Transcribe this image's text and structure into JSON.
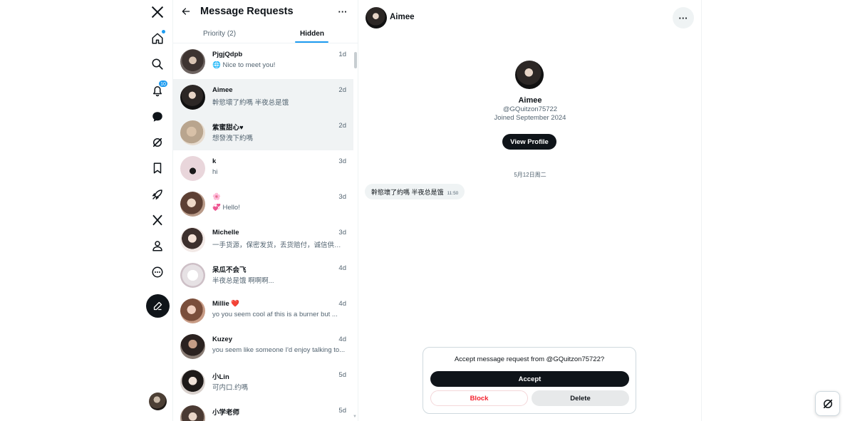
{
  "nav": {
    "notifications_badge": "10",
    "icons": [
      "x-logo-icon",
      "home-icon",
      "search-icon",
      "notifications-icon",
      "messages-icon",
      "grok-icon",
      "bookmarks-icon",
      "rocket-icon",
      "premium-x-icon",
      "profile-icon",
      "more-icon"
    ],
    "compose_icon": "compose-icon"
  },
  "inbox": {
    "title": "Message Requests",
    "tabs": [
      {
        "label": "Priority (2)",
        "active": false
      },
      {
        "label": "Hidden",
        "active": true
      }
    ],
    "conversations": [
      {
        "name": "PjgjQdpb",
        "time": "1d",
        "snippet": "🌐 Nice to meet you!",
        "selected": false
      },
      {
        "name": "Aimee",
        "time": "2d",
        "snippet": "幹慾壞了約嗎 半夜总是饿",
        "selected": true
      },
      {
        "name": "紫蜜甜心♥",
        "time": "2d",
        "snippet": "想發洩下約嗎",
        "selected": true
      },
      {
        "name": "k",
        "time": "3d",
        "snippet": "hi",
        "selected": false
      },
      {
        "name": "🌸",
        "time": "3d",
        "snippet": "💞 Hello!",
        "selected": false
      },
      {
        "name": "Michelle",
        "time": "3d",
        "snippet": "一手货源，保密发货，丢货赔付，诚信供应:...",
        "selected": false
      },
      {
        "name": "呆瓜不会飞",
        "time": "4d",
        "snippet": "半夜总是饿 啊啊啊...",
        "selected": false
      },
      {
        "name": "Millie ❤️",
        "time": "4d",
        "snippet": "yo you seem cool af this is a burner but ...",
        "selected": false
      },
      {
        "name": "Kuzey",
        "time": "4d",
        "snippet": "you seem like someone I'd enjoy talking to...",
        "selected": false
      },
      {
        "name": "小Lin",
        "time": "5d",
        "snippet": "可内口.约嗎",
        "selected": false
      },
      {
        "name": "小学老师",
        "time": "5d",
        "snippet": "",
        "selected": false
      }
    ]
  },
  "conversation": {
    "header_name": "Aimee",
    "profile": {
      "name": "Aimee",
      "handle": "@GQuitzon75722",
      "joined": "Joined September 2024",
      "view_profile_label": "View Profile"
    },
    "date_separator": "5月12日周二",
    "messages": [
      {
        "text": "幹慾壞了約嗎 半夜总是饿",
        "time": "11:50"
      }
    ],
    "request": {
      "prompt": "Accept message request from @GQuitzon75722?",
      "accept_label": "Accept",
      "block_label": "Block",
      "delete_label": "Delete"
    }
  },
  "colors": {
    "accent": "#1d9bf0",
    "danger": "#f4212e",
    "text_primary": "#0f1419",
    "text_secondary": "#536471"
  }
}
